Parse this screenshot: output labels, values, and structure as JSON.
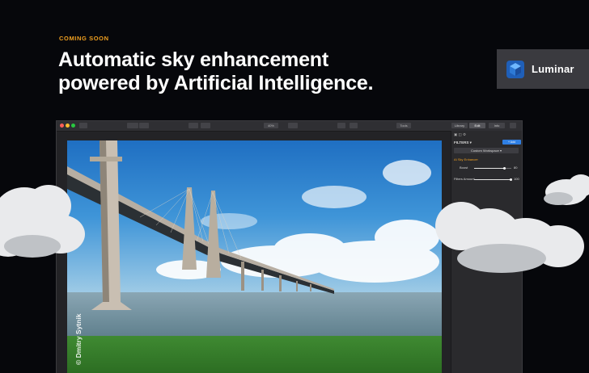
{
  "header": {
    "eyebrow": "COMING SOON",
    "headline_line1": "Automatic sky enhancement",
    "headline_line2": "powered by Artificial Intelligence."
  },
  "brand": {
    "name": "Luminar",
    "icon": "luminar-cube-logo"
  },
  "app": {
    "toolbar": {
      "zoom_label": "40%",
      "tools_label": "Tools",
      "tabs": [
        "Library",
        "Edit",
        "Info"
      ]
    },
    "panel": {
      "filters_title": "FILTERS ▾",
      "add_label": "+ Add",
      "workspace_label": "Custom Workspace ▾",
      "filter_name": "AI Sky Enhancer",
      "sliders": [
        {
          "label": "Boost",
          "value": "80",
          "level": 0.8
        },
        {
          "label": "Filters Amount",
          "value": "100",
          "level": 1.0
        }
      ]
    }
  },
  "photo_credit": "© Dmitry Sytnik",
  "colors": {
    "accent_orange": "#f0a020",
    "brand_panel": "#3a3a3f",
    "add_button": "#2f7fe4",
    "background": "#06070b"
  }
}
